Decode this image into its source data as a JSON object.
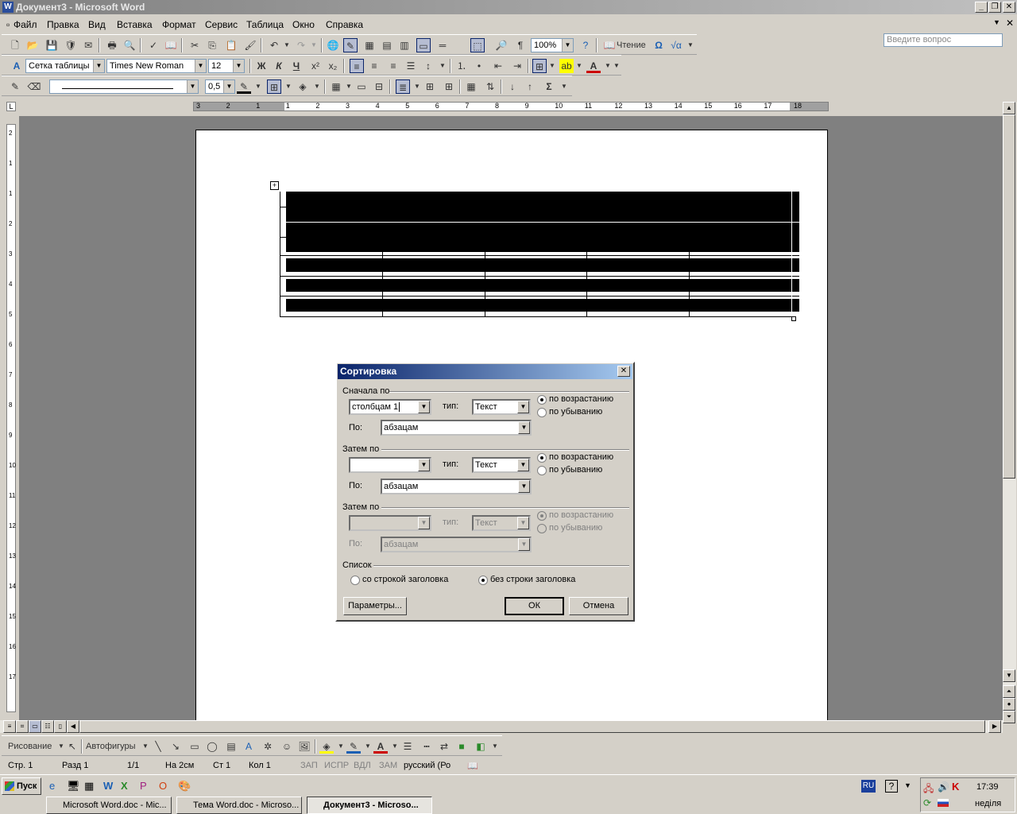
{
  "window": {
    "title": "Документ3 - Microsoft Word",
    "icon_letter": "W"
  },
  "menu": [
    "Файл",
    "Правка",
    "Вид",
    "Вставка",
    "Формат",
    "Сервис",
    "Таблица",
    "Окно",
    "Справка"
  ],
  "ask_placeholder": "Введите вопрос",
  "standard_toolbar": {
    "zoom": "100%",
    "reading_label": "Чтение"
  },
  "formatting_toolbar": {
    "style": "Сетка таблицы",
    "font": "Times New Roman",
    "size": "12",
    "bold": "Ж",
    "italic": "К",
    "underline": "Ч"
  },
  "tables_toolbar": {
    "line_weight": "0,5"
  },
  "ruler_labels": [
    "3",
    "2",
    "1",
    "1",
    "2",
    "3",
    "4",
    "5",
    "6",
    "7",
    "8",
    "9",
    "10",
    "11",
    "12",
    "13",
    "14",
    "15",
    "16",
    "17",
    "18"
  ],
  "vruler_labels": [
    "2",
    "1",
    "1",
    "2",
    "3",
    "4",
    "5",
    "6",
    "7",
    "8",
    "9",
    "10",
    "11",
    "12",
    "13",
    "14",
    "15",
    "16",
    "17"
  ],
  "dialog": {
    "title": "Сортировка",
    "group1": {
      "label": "Сначала по",
      "field": "столбцам 1",
      "type_label": "тип:",
      "type_value": "Текст",
      "by_label": "По:",
      "by_value": "абзацам",
      "asc": "по возрастанию",
      "desc": "по убыванию"
    },
    "group2": {
      "label": "Затем по",
      "field": "",
      "type_label": "тип:",
      "type_value": "Текст",
      "by_label": "По:",
      "by_value": "абзацам",
      "asc": "по возрастанию",
      "desc": "по убыванию"
    },
    "group3": {
      "label": "Затем по",
      "field": "",
      "type_label": "тип:",
      "type_value": "Текст",
      "by_label": "По:",
      "by_value": "абзацам",
      "asc": "по возрастанию",
      "desc": "по убыванию"
    },
    "list": {
      "label": "Список",
      "with_header": "со строкой заголовка",
      "without_header": "без строки заголовка"
    },
    "buttons": {
      "options": "Параметры...",
      "ok": "ОК",
      "cancel": "Отмена"
    }
  },
  "drawing_toolbar": {
    "draw": "Рисование",
    "autoshapes": "Автофигуры"
  },
  "status": {
    "page": "Стр. 1",
    "section": "Разд 1",
    "pages": "1/1",
    "at": "На 2см",
    "line": "Ст 1",
    "col": "Кол 1",
    "rec": "ЗАП",
    "trk": "ИСПР",
    "ext": "ВДЛ",
    "ovr": "ЗАМ",
    "lang": "русский (Ро"
  },
  "taskbar": {
    "start": "Пуск",
    "tasks": [
      "Microsoft Word.doc - Mic...",
      "Тема Word.doc - Microso...",
      "Документ3 - Microso..."
    ],
    "lang": "RU",
    "time": "17:39",
    "day": "неділя"
  }
}
